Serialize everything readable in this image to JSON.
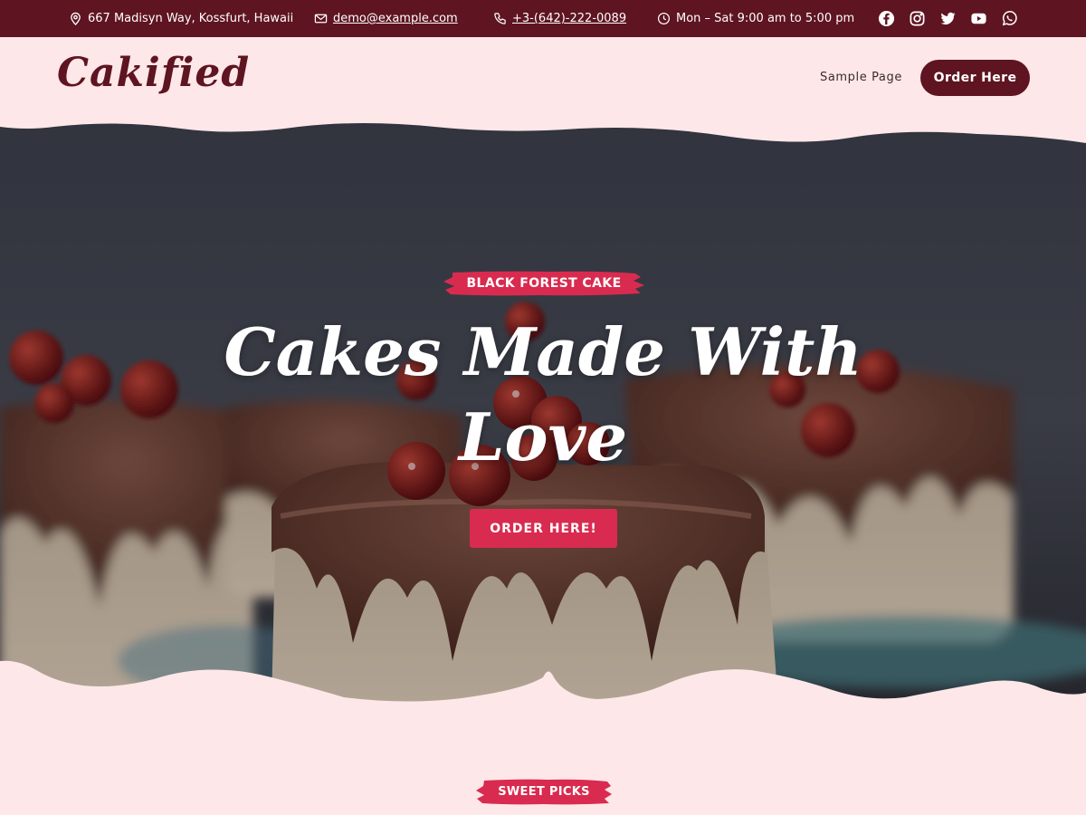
{
  "topbar": {
    "address": "667 Madisyn Way, Kossfurt, Hawaii",
    "email": "demo@example.com",
    "phone": "+3-(642)-222-0089",
    "hours": "Mon – Sat 9:00 am to 5:00 pm",
    "icons": [
      "location-pin-icon",
      "envelope-icon",
      "phone-icon",
      "clock-icon"
    ],
    "social": [
      "facebook-icon",
      "instagram-icon",
      "twitter-icon",
      "youtube-icon",
      "whatsapp-icon"
    ]
  },
  "header": {
    "logo": "Cakified",
    "nav": [
      "Sample Page"
    ],
    "order_button": "Order Here"
  },
  "hero": {
    "badge": "BLACK FOREST CAKE",
    "title": "Cakes Made With Love",
    "cta": "ORDER HERE!"
  },
  "section": {
    "badge": "SWEET PICKS"
  },
  "colors": {
    "topbar_bg": "#5e1421",
    "page_bg": "#fde7e8",
    "accent": "#d92b4f",
    "logo": "#5e1421"
  }
}
